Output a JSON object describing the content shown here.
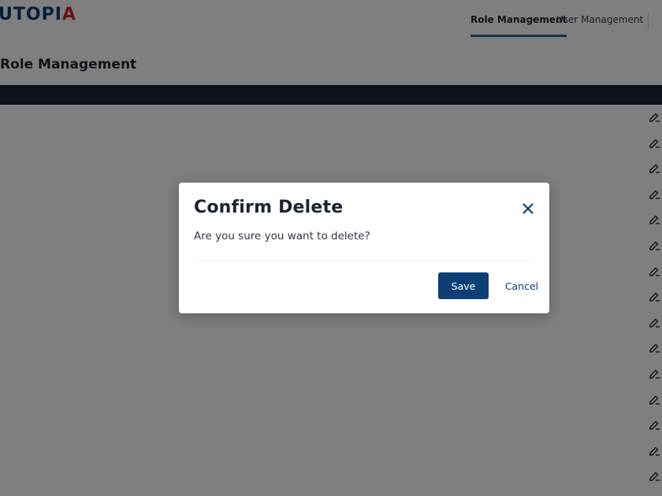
{
  "app": {
    "logo_text_main": "UTOPI",
    "logo_text_accent": "A"
  },
  "nav": {
    "items": [
      {
        "label": "Role Management"
      },
      {
        "label": "User Management"
      }
    ]
  },
  "page": {
    "title": "Role Management"
  },
  "table": {
    "headers": [
      "",
      "",
      "",
      "",
      ""
    ],
    "rows": [
      [
        "",
        "",
        "",
        "",
        ""
      ],
      [
        "",
        "",
        "",
        "",
        ""
      ],
      [
        "",
        "",
        "",
        "",
        ""
      ],
      [
        "",
        "",
        "",
        "",
        ""
      ],
      [
        "",
        "",
        "",
        "",
        ""
      ],
      [
        "",
        "",
        "",
        "",
        ""
      ],
      [
        "",
        "",
        "",
        "",
        ""
      ],
      [
        "",
        "",
        "",
        "",
        ""
      ],
      [
        "",
        "",
        "",
        "",
        ""
      ],
      [
        "",
        "",
        "",
        "",
        ""
      ],
      [
        "",
        "",
        "",
        "",
        ""
      ],
      [
        "",
        "",
        "",
        "",
        ""
      ],
      [
        "",
        "",
        "",
        "",
        ""
      ],
      [
        "",
        "",
        "",
        "",
        ""
      ],
      [
        "",
        "",
        "",
        "",
        ""
      ]
    ]
  },
  "modal": {
    "title": "Confirm Delete",
    "message": "Are you sure you want to delete?",
    "save_label": "Save",
    "cancel_label": "Cancel",
    "close_icon": "close-icon"
  },
  "colors": {
    "primary": "#0d3f77",
    "table_header": "#1a2531",
    "logo_accent": "#d8232a",
    "nav_underline": "#1e68a6",
    "overlay": "rgba(0,0,0,0.5)"
  }
}
